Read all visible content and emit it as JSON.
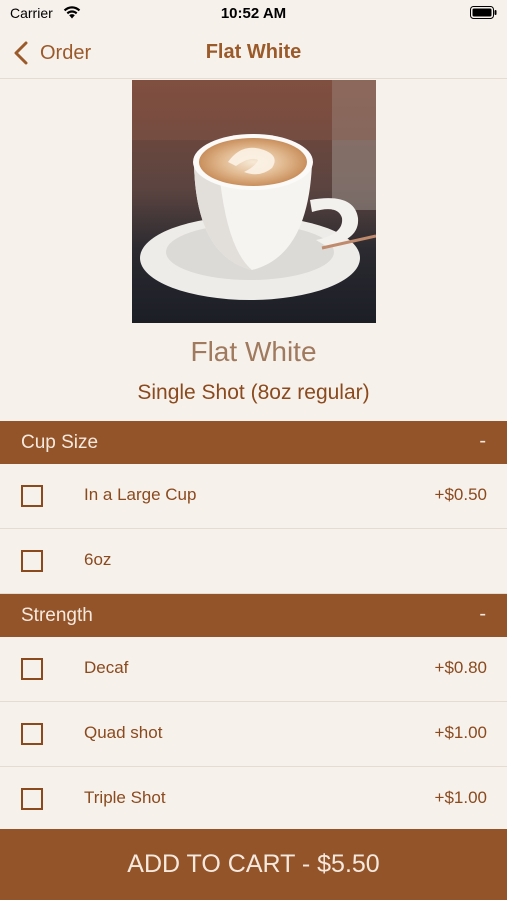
{
  "status_bar": {
    "carrier": "Carrier",
    "time": "10:52 AM"
  },
  "nav": {
    "back_label": "Order",
    "title": "Flat White"
  },
  "product": {
    "name": "Flat White",
    "description": "Single Shot (8oz regular)"
  },
  "sections": [
    {
      "title": "Cup Size",
      "toggle": "-",
      "options": [
        {
          "name": "In a Large Cup",
          "price": "+$0.50",
          "checked": false
        },
        {
          "name": "6oz",
          "price": "",
          "checked": false
        }
      ]
    },
    {
      "title": "Strength",
      "toggle": "-",
      "options": [
        {
          "name": "Decaf",
          "price": "+$0.80",
          "checked": false
        },
        {
          "name": "Quad shot",
          "price": "+$1.00",
          "checked": false
        },
        {
          "name": "Triple Shot",
          "price": "+$1.00",
          "checked": false
        }
      ]
    }
  ],
  "cart": {
    "label": "ADD TO CART - $5.50"
  },
  "colors": {
    "accent": "#94542a",
    "background": "#f7f1ec",
    "text": "#8a4a1e"
  },
  "icons": {
    "back": "chevron-left-icon",
    "wifi": "wifi-icon",
    "battery": "battery-icon"
  }
}
